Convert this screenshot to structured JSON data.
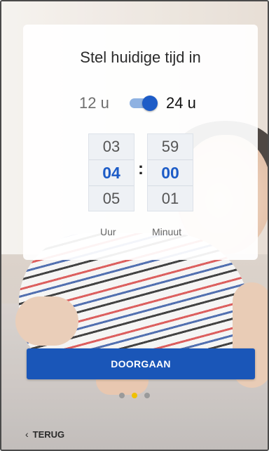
{
  "card": {
    "title": "Stel huidige tijd in",
    "format": {
      "option_12": "12 u",
      "option_24": "24 u",
      "selected": "24 u"
    },
    "hours": {
      "prev": "03",
      "selected": "04",
      "next": "05",
      "label": "Uur"
    },
    "separator": ":",
    "minutes": {
      "prev": "59",
      "selected": "00",
      "next": "01",
      "label": "Minuut"
    }
  },
  "continue_label": "DOORGAAN",
  "back_label": "TERUG",
  "back_icon": "‹",
  "pager": {
    "count": 3,
    "active_index": 1
  },
  "colors": {
    "accent": "#1a56b8",
    "toggle_thumb": "#1d5cc7",
    "active_dot": "#f0c000"
  }
}
